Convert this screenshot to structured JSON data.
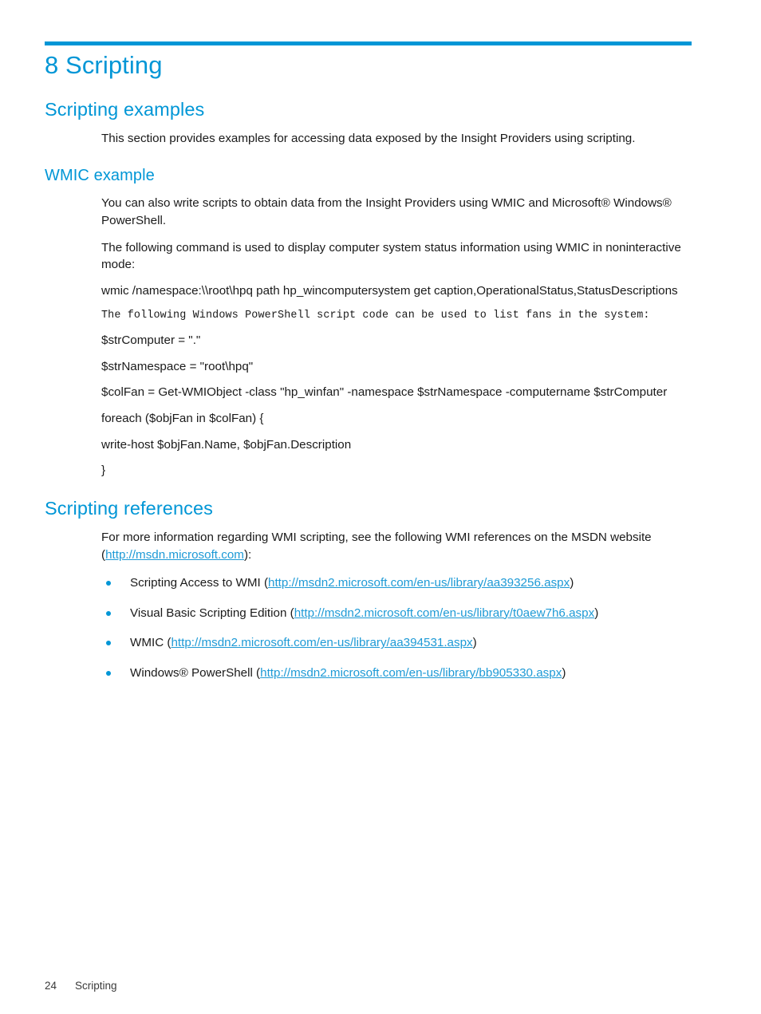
{
  "page": {
    "accent_color": "#0096D6",
    "link_color": "#1E9AD6",
    "text_color": "#1A1A1A",
    "background": "#FFFFFF"
  },
  "chapter": {
    "number": "8",
    "title": "8 Scripting"
  },
  "sections": {
    "scripting_examples": {
      "heading": "Scripting examples",
      "intro": "This section provides examples for accessing data exposed by the Insight Providers using scripting."
    },
    "wmic_example": {
      "heading": "WMIC example",
      "para1": "You can also write scripts to obtain data from the Insight Providers using WMIC and Microsoft® Windows® PowerShell.",
      "para2": "The following command is used to display computer system status information using WMIC in noninteractive mode:",
      "command": "wmic /namespace:\\\\root\\hpq path hp_wincomputersystem get caption,OperationalStatus,StatusDescriptions",
      "mono_note": "The following Windows PowerShell script code can be used to list fans in the system:",
      "script_lines": [
        "$strComputer = \".\"",
        "$strNamespace = \"root\\hpq\"",
        "$colFan = Get-WMIObject -class \"hp_winfan\" -namespace $strNamespace -computername $strComputer",
        "foreach ($objFan in $colFan) {",
        "write-host $objFan.Name, $objFan.Description",
        "}"
      ]
    },
    "scripting_references": {
      "heading": "Scripting references",
      "intro_before_link": "For more information regarding WMI scripting, see the following WMI references on the MSDN website (",
      "intro_link": "http://msdn.microsoft.com",
      "intro_after_link": "):",
      "items": [
        {
          "label": "Scripting Access to WMI (",
          "url": "http://msdn2.microsoft.com/en-us/library/aa393256.aspx",
          "suffix": ")"
        },
        {
          "label": "Visual Basic Scripting Edition (",
          "url": "http://msdn2.microsoft.com/en-us/library/t0aew7h6.aspx",
          "suffix": ")"
        },
        {
          "label": "WMIC (",
          "url": "http://msdn2.microsoft.com/en-us/library/aa394531.aspx",
          "suffix": ")"
        },
        {
          "label": "Windows® PowerShell (",
          "url": "http://msdn2.microsoft.com/en-us/library/bb905330.aspx",
          "suffix": ")"
        }
      ]
    }
  },
  "footer": {
    "page_number": "24",
    "chapter_label": "Scripting"
  }
}
